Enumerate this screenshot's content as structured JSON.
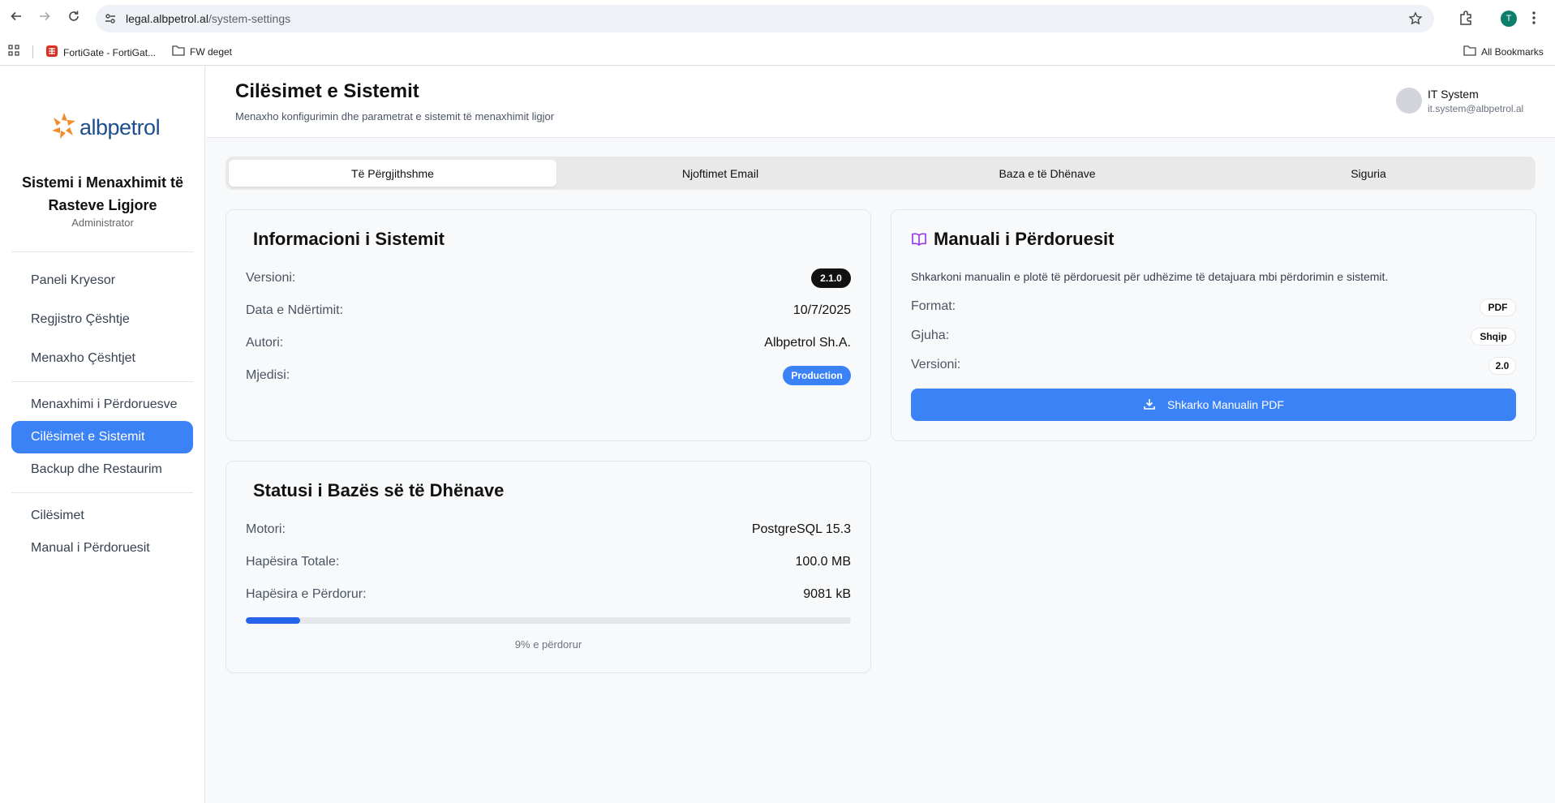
{
  "browser": {
    "url_domain": "legal.albpetrol.al",
    "url_path": "/system-settings",
    "profile_initial": "T",
    "bookmarks": [
      {
        "label": "FortiGate - FortiGat..."
      },
      {
        "label": "FW deget"
      }
    ],
    "all_bookmarks_label": "All Bookmarks"
  },
  "sidebar": {
    "logo_text": "albpetrol",
    "app_title_line1": "Sistemi i Menaxhimit të",
    "app_title_line2": "Rasteve Ligjore",
    "role": "Administrator",
    "items": [
      {
        "label": "Paneli Kryesor"
      },
      {
        "label": "Regjistro Çështje"
      },
      {
        "label": "Menaxho Çështjet"
      },
      {
        "label": "Menaxhimi i Përdoruesve"
      },
      {
        "label": "Cilësimet e Sistemit"
      },
      {
        "label": "Backup dhe Restaurim"
      },
      {
        "label": "Cilësimet"
      },
      {
        "label": "Manual i Përdoruesit"
      }
    ]
  },
  "header": {
    "title": "Cilësimet e Sistemit",
    "subtitle": "Menaxho konfigurimin dhe parametrat e sistemit të menaxhimit ligjor",
    "user_name": "IT System",
    "user_email": "it.system@albpetrol.al"
  },
  "tabs": [
    {
      "label": "Të Përgjithshme"
    },
    {
      "label": "Njoftimet Email"
    },
    {
      "label": "Baza e të Dhënave"
    },
    {
      "label": "Siguria"
    }
  ],
  "system_info": {
    "title": "Informacioni i Sistemit",
    "version_label": "Versioni:",
    "version_value": "2.1.0",
    "build_date_label": "Data e Ndërtimit:",
    "build_date_value": "10/7/2025",
    "author_label": "Autori:",
    "author_value": "Albpetrol Sh.A.",
    "env_label": "Mjedisi:",
    "env_value": "Production"
  },
  "manual": {
    "title": "Manuali i Përdoruesit",
    "description": "Shkarkoni manualin e plotë të përdoruesit për udhëzime të detajuara mbi përdorimin e sistemit.",
    "format_label": "Format:",
    "format_value": "PDF",
    "language_label": "Gjuha:",
    "language_value": "Shqip",
    "version_label": "Versioni:",
    "version_value": "2.0",
    "download_label": "Shkarko Manualin PDF"
  },
  "db_status": {
    "title": "Statusi i Bazës së të Dhënave",
    "engine_label": "Motori:",
    "engine_value": "PostgreSQL 15.3",
    "total_label": "Hapësira Totale:",
    "total_value": "100.0 MB",
    "used_label": "Hapësira e Përdorur:",
    "used_value": "9081 kB",
    "used_percent": 9,
    "used_text": "9% e përdorur"
  },
  "colors": {
    "accent": "#3b82f6",
    "progress": "#2563eb",
    "badge_dark": "#111111",
    "logo_orange": "#f28c28",
    "logo_blue": "#1c4f8f"
  }
}
